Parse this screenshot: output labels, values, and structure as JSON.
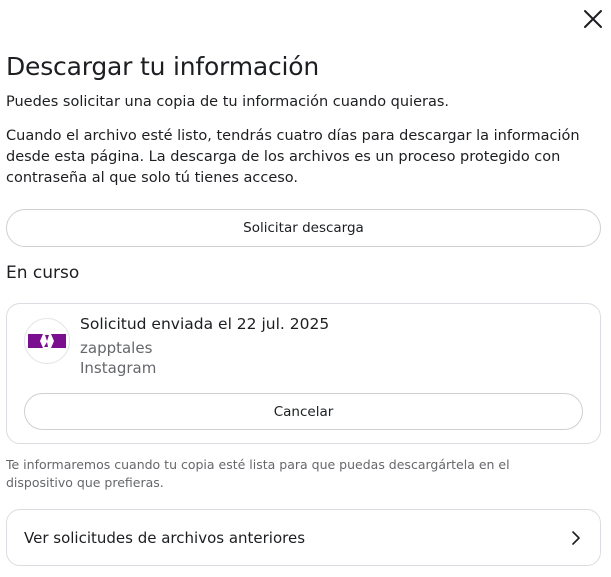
{
  "dialog": {
    "title": "Descargar tu información",
    "description_1": "Puedes solicitar una copia de tu información cuando quieras.",
    "description_2": "Cuando el archivo esté listo, tendrás cuatro días para descargar la información desde esta página. La descarga de los archivos es un proceso protegido con contraseña al que solo tú tienes acceso.",
    "request_button": "Solicitar descarga",
    "close_icon": "close-icon"
  },
  "in_progress": {
    "section_title": "En curso",
    "request": {
      "title": "Solicitud enviada el 22 jul. 2025",
      "account": "zapptales",
      "app": "Instagram",
      "cancel_button": "Cancelar",
      "avatar_color": "#7a0f8f"
    }
  },
  "notice": "Te informaremos cuando tu copia esté lista para que puedas descargártela en el dispositivo que prefieras.",
  "previous": {
    "label": "Ver solicitudes de archivos anteriores",
    "icon": "chevron-right-icon"
  }
}
